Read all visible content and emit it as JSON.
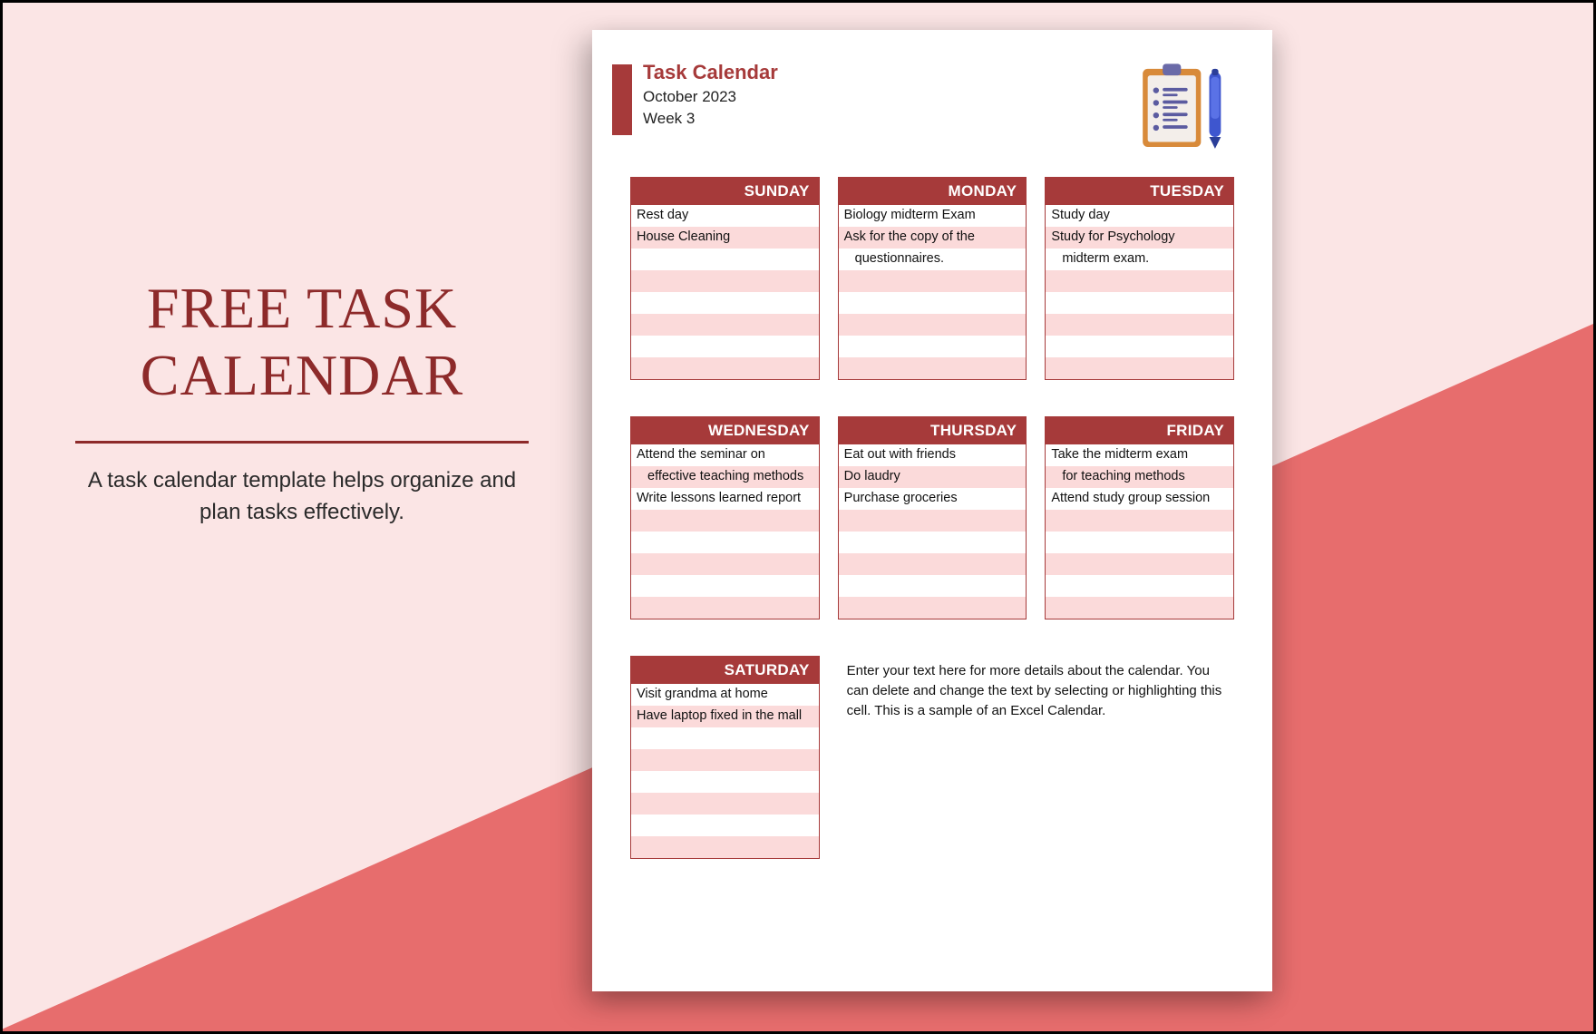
{
  "colors": {
    "accent": "#a63a3a",
    "pink_bg": "#fbe5e5",
    "coral": "#e76d6d",
    "stripe": "#fbdada"
  },
  "left": {
    "title_line1": "FREE TASK",
    "title_line2": "CALENDAR",
    "description": "A task calendar template helps organize and plan tasks effectively."
  },
  "header": {
    "title": "Task Calendar",
    "month": "October 2023",
    "week": "Week 3",
    "icon": "clipboard-with-pen-icon"
  },
  "instructions": "Enter your text here for more details about the calendar. You can delete and change the text by selecting or highlighting this cell. This is a sample of an Excel Calendar.",
  "days": [
    {
      "name": "SUNDAY",
      "rows": [
        {
          "text": "Rest day"
        },
        {
          "text": "House Cleaning"
        },
        {
          "text": ""
        },
        {
          "text": ""
        },
        {
          "text": ""
        },
        {
          "text": ""
        },
        {
          "text": ""
        },
        {
          "text": ""
        }
      ]
    },
    {
      "name": "MONDAY",
      "rows": [
        {
          "text": "Biology midterm Exam"
        },
        {
          "text": "Ask for the copy of the"
        },
        {
          "text": "questionnaires.",
          "indent": true
        },
        {
          "text": ""
        },
        {
          "text": ""
        },
        {
          "text": ""
        },
        {
          "text": ""
        },
        {
          "text": ""
        }
      ]
    },
    {
      "name": "TUESDAY",
      "rows": [
        {
          "text": "Study day"
        },
        {
          "text": "Study for Psychology"
        },
        {
          "text": "midterm exam.",
          "indent": true
        },
        {
          "text": ""
        },
        {
          "text": ""
        },
        {
          "text": ""
        },
        {
          "text": ""
        },
        {
          "text": ""
        }
      ]
    },
    {
      "name": "WEDNESDAY",
      "rows": [
        {
          "text": "Attend the seminar on"
        },
        {
          "text": "effective teaching methods",
          "indent": true
        },
        {
          "text": "Write lessons learned report"
        },
        {
          "text": ""
        },
        {
          "text": ""
        },
        {
          "text": ""
        },
        {
          "text": ""
        },
        {
          "text": ""
        }
      ]
    },
    {
      "name": "THURSDAY",
      "rows": [
        {
          "text": "Eat out with friends"
        },
        {
          "text": "Do laudry"
        },
        {
          "text": "Purchase groceries"
        },
        {
          "text": ""
        },
        {
          "text": ""
        },
        {
          "text": ""
        },
        {
          "text": ""
        },
        {
          "text": ""
        }
      ]
    },
    {
      "name": "FRIDAY",
      "rows": [
        {
          "text": "Take the midterm exam"
        },
        {
          "text": "for teaching methods",
          "indent": true
        },
        {
          "text": "Attend study group session"
        },
        {
          "text": ""
        },
        {
          "text": ""
        },
        {
          "text": ""
        },
        {
          "text": ""
        },
        {
          "text": ""
        }
      ]
    },
    {
      "name": "SATURDAY",
      "rows": [
        {
          "text": "Visit grandma at home"
        },
        {
          "text": "Have laptop fixed in the mall"
        },
        {
          "text": ""
        },
        {
          "text": ""
        },
        {
          "text": ""
        },
        {
          "text": ""
        },
        {
          "text": ""
        },
        {
          "text": ""
        }
      ]
    }
  ]
}
